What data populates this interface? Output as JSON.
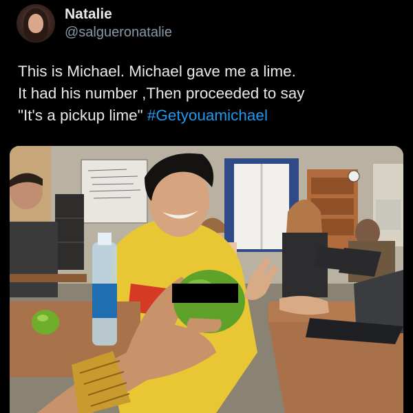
{
  "tweet": {
    "author": {
      "display_name": "Natalie",
      "handle": "@salgueronatalie",
      "avatar_icon": "profile-photo-avatar"
    },
    "text": {
      "line1": "This is Michael. Michael gave me a lime.",
      "line2": "It had his number ,Then proceeded to say",
      "line3_quote": "\"It's a pickup lime\" ",
      "hashtag": "#Getyouamichael"
    },
    "colors": {
      "background": "#000000",
      "text": "#e7e9ea",
      "handle": "#8b98a5",
      "hashtag": "#1d9bf0"
    },
    "photo": {
      "subject": "classroom photo: student holding out a lime with his number written on it (censored)"
    }
  }
}
